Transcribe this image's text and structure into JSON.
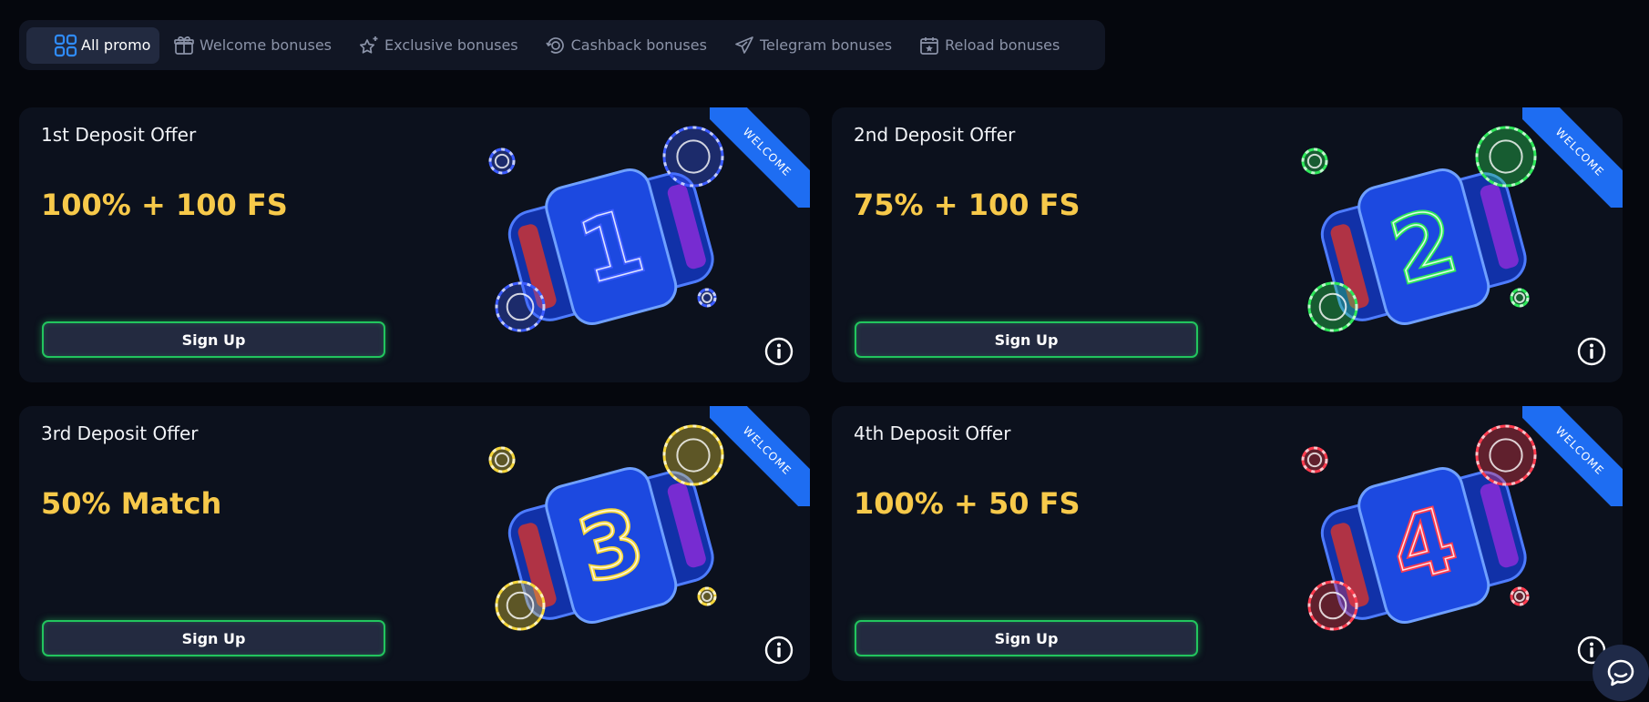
{
  "tabs": [
    {
      "label": "All promo",
      "icon": "grid-icon",
      "active": true
    },
    {
      "label": "Welcome bonuses",
      "icon": "gift-icon",
      "active": false
    },
    {
      "label": "Exclusive bonuses",
      "icon": "star-sparkle-icon",
      "active": false
    },
    {
      "label": "Cashback bonuses",
      "icon": "cashback-coin-icon",
      "active": false
    },
    {
      "label": "Telegram bonuses",
      "icon": "telegram-icon",
      "active": false
    },
    {
      "label": "Reload bonuses",
      "icon": "calendar-star-icon",
      "active": false
    }
  ],
  "cards": [
    {
      "title": "1st Deposit Offer",
      "offer": "100% + 100 FS",
      "button": "Sign Up",
      "ribbon": "WELCOME",
      "digit": "1",
      "accent": "#3b5bff"
    },
    {
      "title": "2nd Deposit Offer",
      "offer": "75% + 100 FS",
      "button": "Sign Up",
      "ribbon": "WELCOME",
      "digit": "2",
      "accent": "#2ee85a"
    },
    {
      "title": "3rd Deposit Offer",
      "offer": "50% Match",
      "button": "Sign Up",
      "ribbon": "WELCOME",
      "digit": "3",
      "accent": "#f5d63a"
    },
    {
      "title": "4th Deposit Offer",
      "offer": "100% + 50 FS",
      "button": "Sign Up",
      "ribbon": "WELCOME",
      "digit": "4",
      "accent": "#ff3b4e"
    }
  ],
  "colors": {
    "offer": "#f7c94a",
    "button_border": "#22c55e",
    "ribbon": "#1e6df2",
    "card_bg": "#0c111d",
    "page_bg": "#05070d"
  },
  "chat": {
    "icon": "chat-bubble-icon"
  }
}
